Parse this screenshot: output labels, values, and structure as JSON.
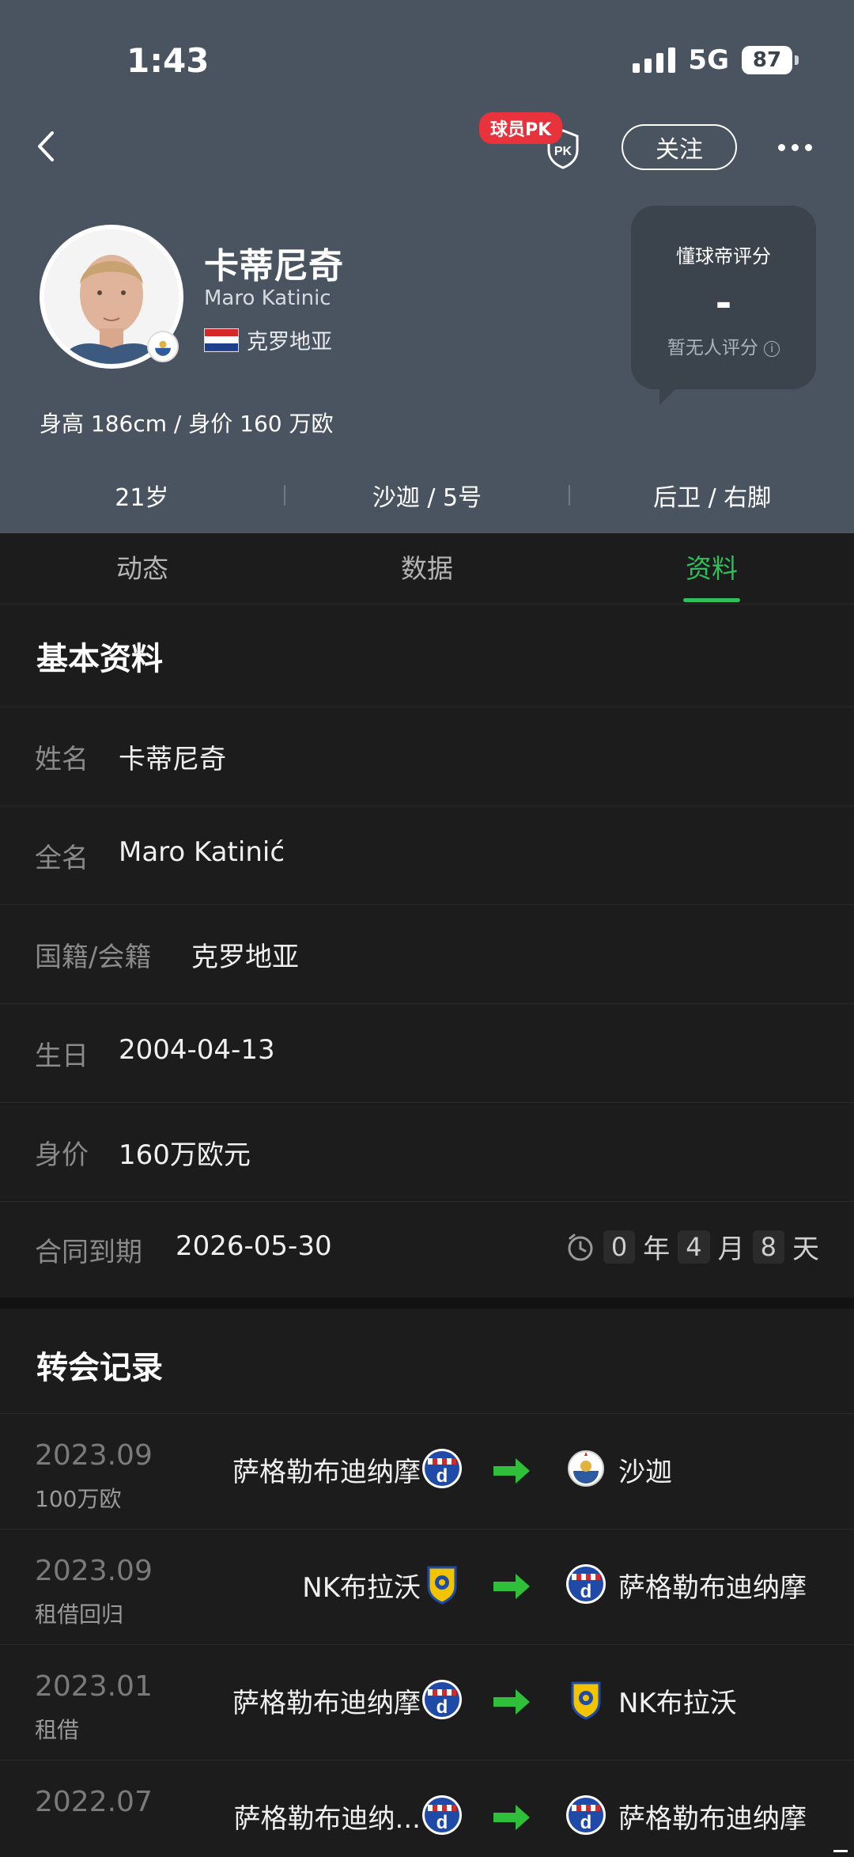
{
  "status": {
    "time": "1:43",
    "network": "5G",
    "battery": "87"
  },
  "header": {
    "pk_badge": "球员PK",
    "pk_shield": "PK",
    "follow_label": "关注"
  },
  "player": {
    "name_cn": "卡蒂尼奇",
    "name_en": "Maro Katinic",
    "country": "克罗地亚",
    "height_value": "身高 186cm / 身价 160 万欧",
    "age": "21岁",
    "club_number": "沙迦 / 5号",
    "position_foot": "后卫 / 右脚"
  },
  "rating": {
    "title": "懂球帝评分",
    "value": "-",
    "note": "暂无人评分",
    "info_icon": "i"
  },
  "tabs": [
    {
      "label": "动态"
    },
    {
      "label": "数据"
    },
    {
      "label": "资料"
    }
  ],
  "basic": {
    "title": "基本资料",
    "rows": [
      {
        "label": "姓名",
        "value": "卡蒂尼奇"
      },
      {
        "label": "全名",
        "value": "Maro Katinić"
      },
      {
        "label": "国籍/会籍",
        "value": "克罗地亚"
      },
      {
        "label": "生日",
        "value": "2004-04-13"
      },
      {
        "label": "身价",
        "value": "160万欧元"
      },
      {
        "label": "合同到期",
        "value": "2026-05-30"
      }
    ],
    "countdown": {
      "years": "0",
      "years_unit": "年",
      "months": "4",
      "months_unit": "月",
      "days": "8",
      "days_unit": "天"
    }
  },
  "transfers": {
    "title": "转会记录",
    "items": [
      {
        "date": "2023.09",
        "note": "100万欧",
        "from": "萨格勒布迪纳摩",
        "to": "沙迦"
      },
      {
        "date": "2023.09",
        "note": "租借回归",
        "from": "NK布拉沃",
        "to": "萨格勒布迪纳摩"
      },
      {
        "date": "2023.01",
        "note": "租借",
        "from": "萨格勒布迪纳摩",
        "to": "NK布拉沃"
      },
      {
        "date": "2022.07",
        "note": "",
        "from": "萨格勒布迪纳...",
        "to": "萨格勒布迪纳摩"
      }
    ]
  },
  "colors": {
    "accent": "#2fbf5b",
    "header_bg": "#4a5460",
    "page_bg": "#1c1c1c",
    "pk_red": "#e8333c"
  }
}
